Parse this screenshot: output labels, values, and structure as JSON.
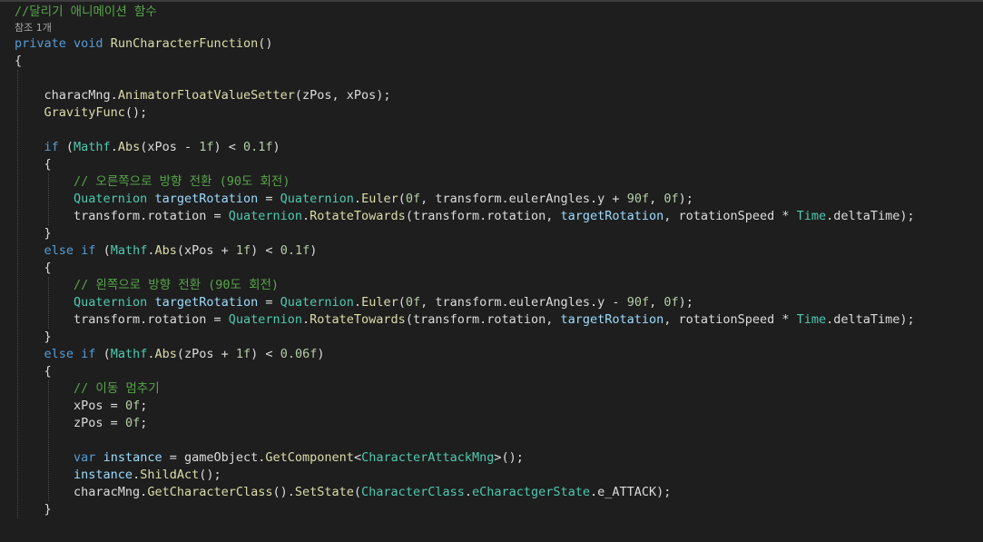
{
  "editor": {
    "language": "C#",
    "colors": {
      "background": "#1e1e1e",
      "comment": "#57a64a",
      "keyword": "#569cd6",
      "type": "#4ec9b0",
      "method": "#dcdcaa",
      "local": "#9cdcfe",
      "number": "#b5cea8",
      "text": "#dcdcdc"
    },
    "references_label": "참조 1개",
    "lines": [
      [
        {
          "t": "//달리기 애니메이션 함수",
          "c": "comment"
        }
      ],
      [
        {
          "t": "private",
          "c": "kw"
        },
        {
          "t": " ",
          "c": "punct"
        },
        {
          "t": "void",
          "c": "kw"
        },
        {
          "t": " ",
          "c": "punct"
        },
        {
          "t": "RunCharacterFunction",
          "c": "method"
        },
        {
          "t": "()",
          "c": "punct"
        }
      ],
      [
        {
          "t": "{",
          "c": "punct"
        }
      ],
      [],
      [
        {
          "t": "    ",
          "c": "punct"
        },
        {
          "t": "characMng",
          "c": "ident"
        },
        {
          "t": ".",
          "c": "punct"
        },
        {
          "t": "AnimatorFloatValueSetter",
          "c": "method"
        },
        {
          "t": "(zPos, xPos);",
          "c": "punct"
        }
      ],
      [
        {
          "t": "    ",
          "c": "punct"
        },
        {
          "t": "GravityFunc",
          "c": "method"
        },
        {
          "t": "();",
          "c": "punct"
        }
      ],
      [],
      [
        {
          "t": "    ",
          "c": "punct"
        },
        {
          "t": "if",
          "c": "kw"
        },
        {
          "t": " (",
          "c": "punct"
        },
        {
          "t": "Mathf",
          "c": "type"
        },
        {
          "t": ".",
          "c": "punct"
        },
        {
          "t": "Abs",
          "c": "method"
        },
        {
          "t": "(xPos - ",
          "c": "punct"
        },
        {
          "t": "1f",
          "c": "num"
        },
        {
          "t": ") < ",
          "c": "punct"
        },
        {
          "t": "0.1f",
          "c": "num"
        },
        {
          "t": ")",
          "c": "punct"
        }
      ],
      [
        {
          "t": "    {",
          "c": "punct"
        }
      ],
      [
        {
          "t": "        ",
          "c": "punct"
        },
        {
          "t": "// 오른쪽으로 방향 전환 (90도 회전)",
          "c": "comment"
        }
      ],
      [
        {
          "t": "        ",
          "c": "punct"
        },
        {
          "t": "Quaternion",
          "c": "type"
        },
        {
          "t": " ",
          "c": "punct"
        },
        {
          "t": "targetRotation",
          "c": "local"
        },
        {
          "t": " = ",
          "c": "punct"
        },
        {
          "t": "Quaternion",
          "c": "type"
        },
        {
          "t": ".",
          "c": "punct"
        },
        {
          "t": "Euler",
          "c": "method"
        },
        {
          "t": "(",
          "c": "punct"
        },
        {
          "t": "0f",
          "c": "num"
        },
        {
          "t": ", transform.eulerAngles.y + ",
          "c": "punct"
        },
        {
          "t": "90f",
          "c": "num"
        },
        {
          "t": ", ",
          "c": "punct"
        },
        {
          "t": "0f",
          "c": "num"
        },
        {
          "t": ");",
          "c": "punct"
        }
      ],
      [
        {
          "t": "        ",
          "c": "punct"
        },
        {
          "t": "transform.rotation = ",
          "c": "punct"
        },
        {
          "t": "Quaternion",
          "c": "type"
        },
        {
          "t": ".",
          "c": "punct"
        },
        {
          "t": "RotateTowards",
          "c": "method"
        },
        {
          "t": "(transform.rotation, ",
          "c": "punct"
        },
        {
          "t": "targetRotation",
          "c": "local"
        },
        {
          "t": ", rotationSpeed * ",
          "c": "punct"
        },
        {
          "t": "Time",
          "c": "type"
        },
        {
          "t": ".deltaTime);",
          "c": "punct"
        }
      ],
      [
        {
          "t": "    }",
          "c": "punct"
        }
      ],
      [
        {
          "t": "    ",
          "c": "punct"
        },
        {
          "t": "else",
          "c": "kw"
        },
        {
          "t": " ",
          "c": "punct"
        },
        {
          "t": "if",
          "c": "kw"
        },
        {
          "t": " (",
          "c": "punct"
        },
        {
          "t": "Mathf",
          "c": "type"
        },
        {
          "t": ".",
          "c": "punct"
        },
        {
          "t": "Abs",
          "c": "method"
        },
        {
          "t": "(xPos + ",
          "c": "punct"
        },
        {
          "t": "1f",
          "c": "num"
        },
        {
          "t": ") < ",
          "c": "punct"
        },
        {
          "t": "0.1f",
          "c": "num"
        },
        {
          "t": ")",
          "c": "punct"
        }
      ],
      [
        {
          "t": "    {",
          "c": "punct"
        }
      ],
      [
        {
          "t": "        ",
          "c": "punct"
        },
        {
          "t": "// 왼쪽으로 방향 전환 (90도 회전)",
          "c": "comment"
        }
      ],
      [
        {
          "t": "        ",
          "c": "punct"
        },
        {
          "t": "Quaternion",
          "c": "type"
        },
        {
          "t": " ",
          "c": "punct"
        },
        {
          "t": "targetRotation",
          "c": "local"
        },
        {
          "t": " = ",
          "c": "punct"
        },
        {
          "t": "Quaternion",
          "c": "type"
        },
        {
          "t": ".",
          "c": "punct"
        },
        {
          "t": "Euler",
          "c": "method"
        },
        {
          "t": "(",
          "c": "punct"
        },
        {
          "t": "0f",
          "c": "num"
        },
        {
          "t": ", transform.eulerAngles.y - ",
          "c": "punct"
        },
        {
          "t": "90f",
          "c": "num"
        },
        {
          "t": ", ",
          "c": "punct"
        },
        {
          "t": "0f",
          "c": "num"
        },
        {
          "t": ");",
          "c": "punct"
        }
      ],
      [
        {
          "t": "        ",
          "c": "punct"
        },
        {
          "t": "transform.rotation = ",
          "c": "punct"
        },
        {
          "t": "Quaternion",
          "c": "type"
        },
        {
          "t": ".",
          "c": "punct"
        },
        {
          "t": "RotateTowards",
          "c": "method"
        },
        {
          "t": "(transform.rotation, ",
          "c": "punct"
        },
        {
          "t": "targetRotation",
          "c": "local"
        },
        {
          "t": ", rotationSpeed * ",
          "c": "punct"
        },
        {
          "t": "Time",
          "c": "type"
        },
        {
          "t": ".deltaTime);",
          "c": "punct"
        }
      ],
      [
        {
          "t": "    }",
          "c": "punct"
        }
      ],
      [
        {
          "t": "    ",
          "c": "punct"
        },
        {
          "t": "else",
          "c": "kw"
        },
        {
          "t": " ",
          "c": "punct"
        },
        {
          "t": "if",
          "c": "kw"
        },
        {
          "t": " (",
          "c": "punct"
        },
        {
          "t": "Mathf",
          "c": "type"
        },
        {
          "t": ".",
          "c": "punct"
        },
        {
          "t": "Abs",
          "c": "method"
        },
        {
          "t": "(zPos + ",
          "c": "punct"
        },
        {
          "t": "1f",
          "c": "num"
        },
        {
          "t": ") < ",
          "c": "punct"
        },
        {
          "t": "0.06f",
          "c": "num"
        },
        {
          "t": ")",
          "c": "punct"
        }
      ],
      [
        {
          "t": "    {",
          "c": "punct"
        }
      ],
      [
        {
          "t": "        ",
          "c": "punct"
        },
        {
          "t": "// 이동 멈추기",
          "c": "comment"
        }
      ],
      [
        {
          "t": "        ",
          "c": "punct"
        },
        {
          "t": "xPos = ",
          "c": "punct"
        },
        {
          "t": "0f",
          "c": "num"
        },
        {
          "t": ";",
          "c": "punct"
        }
      ],
      [
        {
          "t": "        ",
          "c": "punct"
        },
        {
          "t": "zPos = ",
          "c": "punct"
        },
        {
          "t": "0f",
          "c": "num"
        },
        {
          "t": ";",
          "c": "punct"
        }
      ],
      [],
      [
        {
          "t": "        ",
          "c": "punct"
        },
        {
          "t": "var",
          "c": "kw"
        },
        {
          "t": " ",
          "c": "punct"
        },
        {
          "t": "instance",
          "c": "local"
        },
        {
          "t": " = gameObject.",
          "c": "punct"
        },
        {
          "t": "GetComponent",
          "c": "method"
        },
        {
          "t": "<",
          "c": "punct"
        },
        {
          "t": "CharacterAttackMng",
          "c": "type"
        },
        {
          "t": ">();",
          "c": "punct"
        }
      ],
      [
        {
          "t": "        ",
          "c": "punct"
        },
        {
          "t": "instance",
          "c": "local"
        },
        {
          "t": ".",
          "c": "punct"
        },
        {
          "t": "ShildAct",
          "c": "method"
        },
        {
          "t": "();",
          "c": "punct"
        }
      ],
      [
        {
          "t": "        ",
          "c": "punct"
        },
        {
          "t": "characMng.",
          "c": "punct"
        },
        {
          "t": "GetCharacterClass",
          "c": "method"
        },
        {
          "t": "().",
          "c": "punct"
        },
        {
          "t": "SetState",
          "c": "method"
        },
        {
          "t": "(",
          "c": "punct"
        },
        {
          "t": "CharacterClass",
          "c": "type"
        },
        {
          "t": ".",
          "c": "punct"
        },
        {
          "t": "eCharactgerState",
          "c": "type"
        },
        {
          "t": ".e_ATTACK);",
          "c": "punct"
        }
      ],
      [
        {
          "t": "    }",
          "c": "punct"
        }
      ]
    ]
  }
}
